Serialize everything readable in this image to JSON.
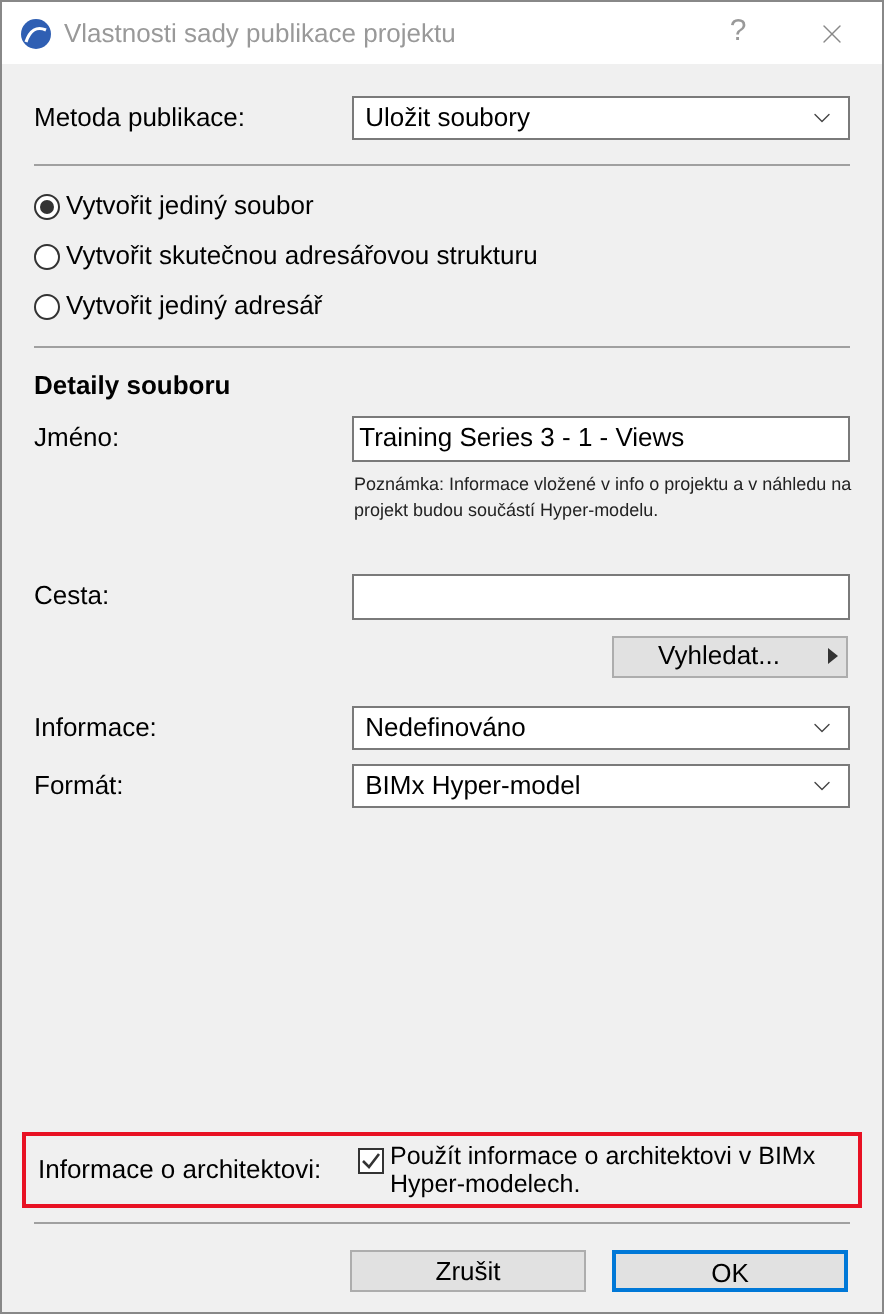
{
  "window": {
    "title": "Vlastnosti sady publikace projektu",
    "help": "?"
  },
  "method": {
    "label": "Metoda publikace:",
    "value": "Uložit soubory"
  },
  "options": [
    {
      "label": "Vytvořit jediný soubor",
      "selected": true
    },
    {
      "label": "Vytvořit skutečnou adresářovou strukturu",
      "selected": false
    },
    {
      "label": "Vytvořit jediný adresář",
      "selected": false
    }
  ],
  "details": {
    "heading": "Detaily souboru",
    "name_label": "Jméno:",
    "name_value": "Training Series 3 - 1 - Views",
    "note": "Poznámka: Informace vložené v info o projektu a v náhledu na projekt budou součástí Hyper-modelu.",
    "path_label": "Cesta:",
    "browse": "Vyhledat..."
  },
  "selects": [
    {
      "label": "Informace:",
      "value": "Nedefinováno"
    },
    {
      "label": "Formát:",
      "value": "BIMx Hyper-model"
    }
  ],
  "architect": {
    "label": "Informace o architektovi:",
    "checkbox": "Použít informace o architektovi v BIMx Hyper-modelech.",
    "checked": true
  },
  "buttons": [
    {
      "label": "Zrušit",
      "default": false
    },
    {
      "label": "OK",
      "default": true
    }
  ]
}
